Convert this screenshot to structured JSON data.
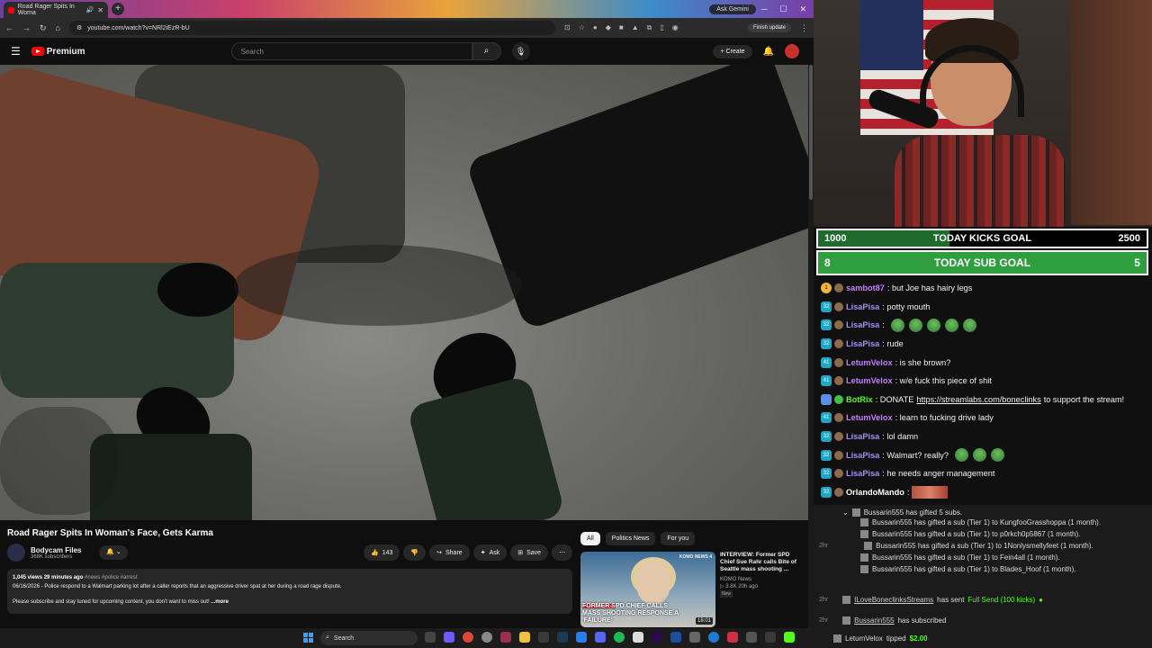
{
  "browser": {
    "tab_title": "Road Rager Spits In Woma",
    "ask_gemini": "Ask Gemini",
    "url": "youtube.com/watch?v=NRl2iEzR-bU",
    "finish_update": "Finish update"
  },
  "youtube": {
    "logo": "Premium",
    "search_placeholder": "Search",
    "create": "Create",
    "video_title": "Road Rager Spits In Woman's Face, Gets Karma",
    "channel_name": "Bodycam Files",
    "subscribers": "368K subscribers",
    "likes": "143",
    "share": "Share",
    "ask": "Ask",
    "save": "Save",
    "desc_stats": "1,045 views  29 minutes ago",
    "desc_tags": "#news #police #arrest",
    "desc_line1": "06/16/2026 - Police respond to a Walmart parking lot after a caller reports that an aggressive driver spat at her during a road rage dispute.",
    "desc_line2": "Please subscribe and stay tuned for upcoming content, you don't want to miss out!",
    "desc_more": "...more",
    "chips": [
      "All",
      "Politics News",
      "For you"
    ],
    "rec": {
      "title": "INTERVIEW: Former SPD Chief Sue Rahr calls Bite of Seattle mass shooting ...",
      "channel": "KOMO News",
      "meta": "3.8K  20h ago",
      "badge": "New",
      "thumb_caption": "FORMER SPD CHIEF CALLS MASS SHOOTING RESPONSE A 'FAILURE'",
      "thumb_tag": "FULL INTERVIEW",
      "thumb_logo": "KOMO NEWS 4",
      "duration": "18:01"
    }
  },
  "taskbar": {
    "search": "Search"
  },
  "stream": {
    "goal1": {
      "left": "1000",
      "label": "TODAY KICKS GOAL",
      "right": "2500",
      "progress": 0.4
    },
    "goal2": {
      "left": "8",
      "label": "TODAY SUB GOAL",
      "right": "5"
    },
    "chat": [
      {
        "user": "sambot87",
        "text": ": but Joe has hairy legs",
        "color": "#c77dff",
        "badge": "1",
        "badge_type": "gift"
      },
      {
        "user": "LisaPisa",
        "text": ": potty mouth",
        "color": "#a78bff",
        "badge": "32",
        "badge_type": "sub"
      },
      {
        "user": "LisaPisa",
        "text": ":",
        "color": "#a78bff",
        "badge": "32",
        "badge_type": "sub",
        "emotes": 5
      },
      {
        "user": "LisaPisa",
        "text": ": rude",
        "color": "#a78bff",
        "badge": "32",
        "badge_type": "sub"
      },
      {
        "user": "LetumVelox",
        "text": ": is she brown?",
        "color": "#c77dff",
        "badge": "41",
        "badge_type": "sub"
      },
      {
        "user": "LetumVelox",
        "text": ": w/e fuck this piece of shit",
        "color": "#c77dff",
        "badge": "41",
        "badge_type": "sub"
      },
      {
        "user": "BotRix",
        "text": ": DONATE ",
        "link": "https://streamlabs.com/boneclinks",
        "after": " to support the stream!",
        "color": "#53fc18",
        "badge": "",
        "badge_type": "mod"
      },
      {
        "user": "LetumVelox",
        "text": ": learn to fucking drive lady",
        "color": "#c77dff",
        "badge": "41",
        "badge_type": "sub"
      },
      {
        "user": "LisaPisa",
        "text": ": lol damn",
        "color": "#a78bff",
        "badge": "32",
        "badge_type": "sub"
      },
      {
        "user": "LisaPisa",
        "text": ": Walmart? really?",
        "color": "#a78bff",
        "badge": "32",
        "badge_type": "sub",
        "emotes": 3
      },
      {
        "user": "LisaPisa",
        "text": ": he needs anger management",
        "color": "#a78bff",
        "badge": "32",
        "badge_type": "sub"
      },
      {
        "user": "OrlandoMando",
        "text": ": ",
        "color": "#ffffff",
        "badge": "32",
        "badge_type": "sub",
        "censor": true
      }
    ],
    "events": {
      "gift_head": "Bussarin555 has gifted 5 subs.",
      "gift_lines": [
        "Bussarin555 has gifted a sub (Tier 1) to KungfooGrasshoppa (1 month).",
        "Bussarin555 has gifted a sub (Tier 1) to p0rkch0p5867 (1 month).",
        "Bussarin555 has gifted a sub (Tier 1) to 1Nonlysmellyfeet (1 month).",
        "Bussarin555 has gifted a sub (Tier 1) to Fein4all (1 month).",
        "Bussarin555 has gifted a sub (Tier 1) to Blades_Hoof (1 month)."
      ],
      "time": "2hr",
      "send_user": "ILoveBoneclinksStreams",
      "send_text": "has sent",
      "send_item": "Full Send (100 kicks)",
      "sub_user": "Bussarin555",
      "sub_text": "has subscribed",
      "tip_user": "LetumVelox",
      "tip_text": "tipped",
      "tip_amount": "$2.00"
    }
  }
}
